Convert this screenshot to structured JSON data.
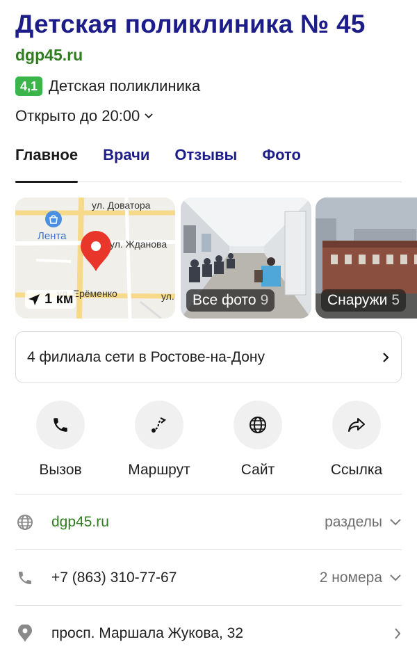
{
  "header": {
    "title": "Детская поликлиника № 45",
    "site": "dgp45.ru",
    "rating": "4,1",
    "category": "Детская поликлиника",
    "hours": "Открыто до 20:00"
  },
  "tabs": [
    {
      "label": "Главное",
      "active": true
    },
    {
      "label": "Врачи"
    },
    {
      "label": "Отзывы"
    },
    {
      "label": "Фото"
    }
  ],
  "gallery": {
    "map": {
      "streets": [
        "ул. Доватора",
        "ул. Жданова",
        "ул. Ерёменко",
        "ул."
      ],
      "poi": "Лента",
      "distance": "1 км"
    },
    "all_photos": {
      "label": "Все фото",
      "count": "9"
    },
    "outside": {
      "label": "Снаружи",
      "count": "5"
    }
  },
  "branches": {
    "label": "4 филиала сети в Ростове-на-Дону"
  },
  "actions": [
    {
      "label": "Вызов",
      "icon": "phone-icon"
    },
    {
      "label": "Маршрут",
      "icon": "route-icon"
    },
    {
      "label": "Сайт",
      "icon": "globe-icon"
    },
    {
      "label": "Ссылка",
      "icon": "share-icon"
    }
  ],
  "info": {
    "website": {
      "value": "dgp45.ru",
      "extra": "разделы"
    },
    "phone": {
      "value": "+7 (863) 310-77-67",
      "extra": "2 номера"
    },
    "address": {
      "value": "просп. Маршала Жукова, 32"
    }
  },
  "colors": {
    "title": "#1d1d8a",
    "link": "#2f7d1f",
    "rating": "#3bb54a",
    "pin": "#e8362b"
  }
}
